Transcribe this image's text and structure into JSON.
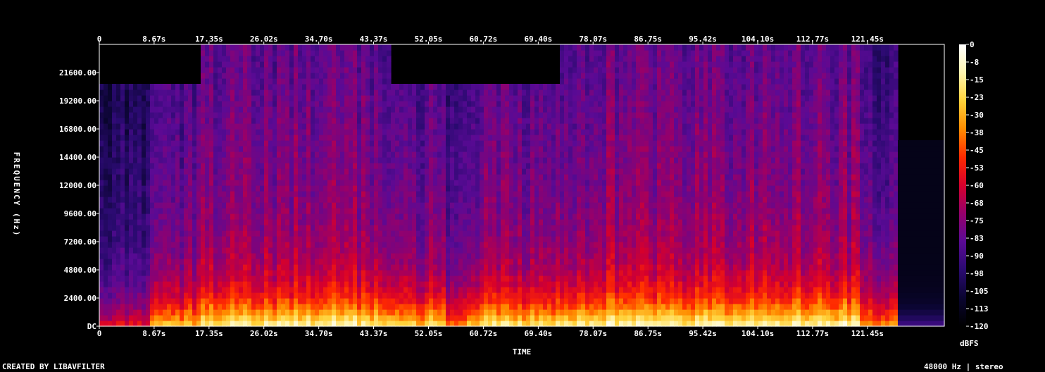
{
  "chart_data": {
    "type": "heatmap",
    "title": "",
    "xlabel": "TIME",
    "ylabel": "FREQUENCY (Hz)",
    "x_tick_labels": [
      "0",
      "8.67s",
      "17.35s",
      "26.02s",
      "34.70s",
      "43.37s",
      "52.05s",
      "60.72s",
      "69.40s",
      "78.07s",
      "86.75s",
      "95.42s",
      "104.10s",
      "112.77s",
      "121.45s"
    ],
    "x_tick_values": [
      0,
      8.67,
      17.35,
      26.02,
      34.7,
      43.37,
      52.05,
      60.72,
      69.4,
      78.07,
      86.75,
      95.42,
      104.1,
      112.77,
      121.45
    ],
    "xlim": [
      0,
      133.6
    ],
    "y_tick_labels": [
      "DC",
      "2400.00",
      "4800.00",
      "7200.00",
      "9600.00",
      "12000.00",
      "14400.00",
      "16800.00",
      "19200.00",
      "21600.00"
    ],
    "y_tick_values": [
      0,
      2400,
      4800,
      7200,
      9600,
      12000,
      14400,
      16800,
      19200,
      21600
    ],
    "ylim": [
      0,
      24000
    ],
    "colorbar": {
      "label": "dBFS",
      "tick_labels": [
        "0",
        "-8",
        "-15",
        "-23",
        "-30",
        "-38",
        "-45",
        "-53",
        "-60",
        "-68",
        "-75",
        "-83",
        "-90",
        "-98",
        "-105",
        "-113",
        "-120"
      ],
      "range": [
        -120,
        0
      ],
      "colors": [
        "#ffffff",
        "#fff5b0",
        "#ffd23a",
        "#ff8c00",
        "#ff2a00",
        "#d6002c",
        "#95006b",
        "#5a0a95",
        "#2a0a70",
        "#0a0530",
        "#000000"
      ]
    },
    "segments": [
      {
        "start": 0.0,
        "end": 8.0,
        "cutoff_hz": 20500,
        "level": 0.5
      },
      {
        "start": 8.0,
        "end": 15.8,
        "cutoff_hz": 20600,
        "level": 0.72
      },
      {
        "start": 15.8,
        "end": 46.2,
        "cutoff_hz": 24000,
        "level": 0.85
      },
      {
        "start": 46.2,
        "end": 55.0,
        "cutoff_hz": 20600,
        "level": 0.78
      },
      {
        "start": 55.0,
        "end": 58.0,
        "cutoff_hz": 20400,
        "level": 0.62
      },
      {
        "start": 58.0,
        "end": 73.0,
        "cutoff_hz": 20600,
        "level": 0.8
      },
      {
        "start": 73.0,
        "end": 120.5,
        "cutoff_hz": 24000,
        "level": 0.86
      },
      {
        "start": 120.5,
        "end": 126.0,
        "cutoff_hz": 24000,
        "level": 0.66
      },
      {
        "start": 126.0,
        "end": 133.6,
        "cutoff_hz": 16000,
        "level": 0.22
      }
    ]
  },
  "footer": {
    "left": "CREATED BY LIBAVFILTER",
    "right": "48000 Hz | stereo"
  }
}
